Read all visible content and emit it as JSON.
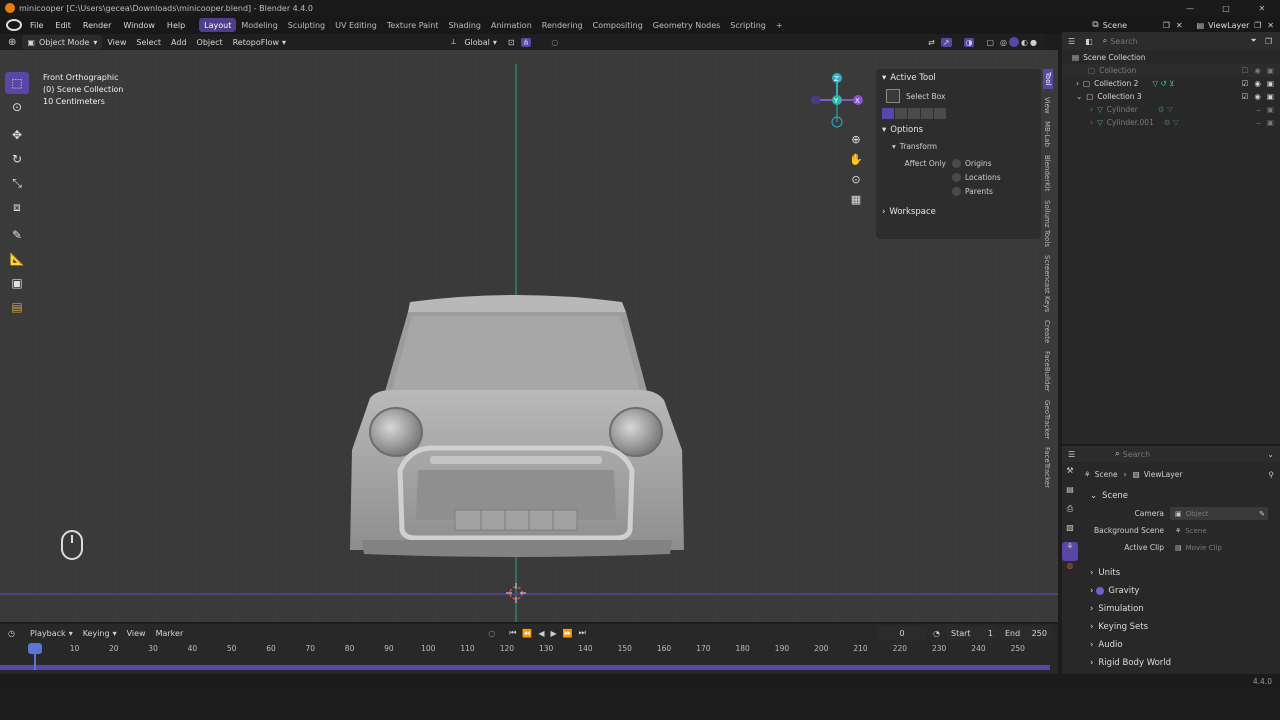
{
  "window": {
    "title": "minicooper [C:\\Users\\gecea\\Downloads\\minicooper.blend] - Blender 4.4.0",
    "min": "—",
    "max": "□",
    "close": "✕"
  },
  "menu": {
    "items": [
      "File",
      "Edit",
      "Render",
      "Window",
      "Help"
    ],
    "workspaces": [
      "Layout",
      "Modeling",
      "Sculpting",
      "UV Editing",
      "Texture Paint",
      "Shading",
      "Animation",
      "Rendering",
      "Compositing",
      "Geometry Nodes",
      "Scripting"
    ],
    "add_tab": "+",
    "scene": "Scene",
    "view_layer": "ViewLayer"
  },
  "header": {
    "mode": "Object Mode",
    "view": "View",
    "select": "Select",
    "add": "Add",
    "object": "Object",
    "addon": "RetopoFlow",
    "orientation": "Global",
    "search_placeholder": "Search",
    "options": "Options"
  },
  "overlay": {
    "view_name": "Front Orthographic",
    "collection": "(0) Scene Collection",
    "scale": "10 Centimeters"
  },
  "gizmo": {
    "z": "Z",
    "y": "Y",
    "x": "X"
  },
  "npanel": {
    "active_tool": "Active Tool",
    "tool_name": "Select Box",
    "options": "Options",
    "transform": "Transform",
    "affect_only": "Affect Only",
    "origins": "Origins",
    "locations": "Locations",
    "parents": "Parents",
    "workspace": "Workspace"
  },
  "vtabs": [
    "Tool",
    "View",
    "MB-Lab",
    "BlenderKit",
    "Sollumz Tools",
    "Screencast Keys",
    "Create",
    "FaceBuilder",
    "GeoTracker",
    "FaceTracker"
  ],
  "outliner": {
    "search_placeholder": "Search",
    "root": "Scene Collection",
    "items": [
      "Collection",
      "Collection 2",
      "Collection 3",
      "Cylinder",
      "Cylinder.001"
    ]
  },
  "properties": {
    "search_placeholder": "Search",
    "breadcrumb_scene": "Scene",
    "breadcrumb_layer": "ViewLayer",
    "section": "Scene",
    "camera_label": "Camera",
    "camera_value": "Object",
    "bg_label": "Background Scene",
    "bg_value": "Scene",
    "clip_label": "Active Clip",
    "clip_value": "Movie Clip",
    "subsections": [
      "Units",
      "Gravity",
      "Simulation",
      "Keying Sets",
      "Audio",
      "Rigid Body World"
    ]
  },
  "timeline": {
    "playback": "Playback",
    "keying": "Keying",
    "view": "View",
    "marker": "Marker",
    "current_frame": "0",
    "start_label": "Start",
    "start": "1",
    "end_label": "End",
    "end": "250",
    "ticks": [
      "0",
      "10",
      "20",
      "30",
      "40",
      "50",
      "60",
      "70",
      "80",
      "90",
      "100",
      "110",
      "120",
      "130",
      "140",
      "150",
      "160",
      "170",
      "180",
      "190",
      "200",
      "210",
      "220",
      "230",
      "240",
      "250"
    ]
  },
  "status": {
    "version": "4.4.0"
  },
  "colors": {
    "accent": "#5a46a6",
    "x_axis": "#8855cc",
    "y_axis": "#2bb8a8",
    "z_axis": "#2ab0c8"
  }
}
